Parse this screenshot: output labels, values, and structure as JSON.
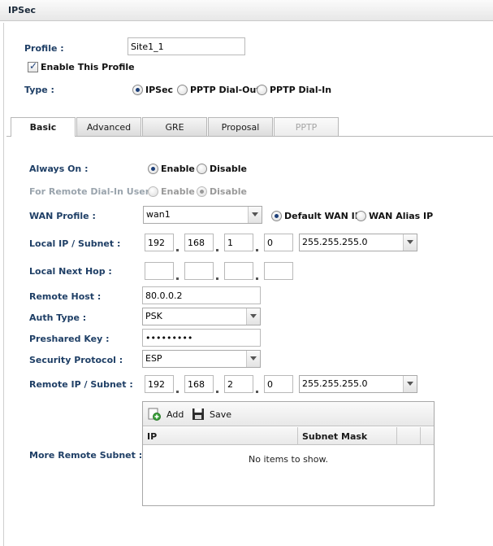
{
  "window": {
    "title": "IPSec"
  },
  "profile": {
    "label": "Profile :",
    "value": "Site1_1"
  },
  "enable_profile": {
    "label": "Enable This Profile",
    "checked": true
  },
  "type": {
    "label": "Type :",
    "options": [
      {
        "label": "IPSec",
        "selected": true
      },
      {
        "label": "PPTP Dial-Out",
        "selected": false
      },
      {
        "label": "PPTP Dial-In",
        "selected": false
      }
    ]
  },
  "tabs": [
    {
      "label": "Basic",
      "state": "active"
    },
    {
      "label": "Advanced",
      "state": "normal"
    },
    {
      "label": "GRE",
      "state": "normal"
    },
    {
      "label": "Proposal",
      "state": "normal"
    },
    {
      "label": "PPTP",
      "state": "disabled"
    }
  ],
  "always_on": {
    "label": "Always On :",
    "enable": "Enable",
    "disable": "Disable",
    "value": "Enable"
  },
  "remote_dialin": {
    "label": "For Remote Dial-In User :",
    "enable": "Enable",
    "disable": "Disable",
    "value": "Disable",
    "disabled": true
  },
  "wan_profile": {
    "label": "WAN Profile :",
    "value": "wan1",
    "default_ip": "Default WAN IP",
    "alias_ip": "WAN Alias IP",
    "ip_choice": "Default WAN IP"
  },
  "local_ip": {
    "label": "Local IP / Subnet :",
    "octets": [
      "192",
      "168",
      "1",
      "0"
    ],
    "mask": "255.255.255.0"
  },
  "local_next_hop": {
    "label": "Local Next Hop :",
    "octets": [
      "",
      "",
      "",
      ""
    ]
  },
  "remote_host": {
    "label": "Remote Host :",
    "value": "80.0.0.2"
  },
  "auth_type": {
    "label": "Auth Type :",
    "value": "PSK"
  },
  "preshared_key": {
    "label": "Preshared Key :",
    "value": "•••••••••"
  },
  "security_protocol": {
    "label": "Security Protocol :",
    "value": "ESP"
  },
  "remote_ip": {
    "label": "Remote IP / Subnet :",
    "octets": [
      "192",
      "168",
      "2",
      "0"
    ],
    "mask": "255.255.255.0"
  },
  "more_remote_subnet": {
    "label": "More Remote Subnet :",
    "add_label": "Add",
    "save_label": "Save",
    "columns": [
      "IP",
      "Subnet Mask"
    ],
    "empty_text": "No items to show."
  },
  "colors": {
    "label_blue": "#1f3f66",
    "disabled_gray": "#9aa4ad"
  }
}
